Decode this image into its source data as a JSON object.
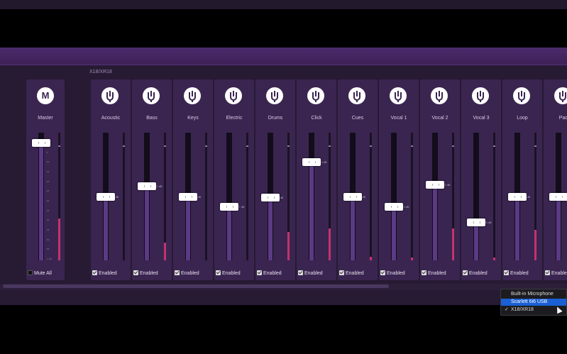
{
  "bus_label": "X18/XR18",
  "master": {
    "knob_letter": "M",
    "name": "Master",
    "level": 0.92,
    "meter": 0.33,
    "scale": [
      "0",
      "-5",
      "-10",
      "-15",
      "-20",
      "-25",
      "-30",
      "-35",
      "-40",
      "-45",
      "-50",
      "-55",
      "-∞ dB"
    ],
    "mute_label": "Mute All"
  },
  "channels": [
    {
      "name": "Acoustic",
      "gain": "-dB",
      "level": 0.5,
      "meter": 0.0,
      "enabled_label": "Enabled"
    },
    {
      "name": "Bass",
      "gain": "-2 dB",
      "level": 0.58,
      "meter": 0.14,
      "enabled_label": "Enabled"
    },
    {
      "name": "Keys",
      "gain": "-dB",
      "level": 0.5,
      "meter": 0.0,
      "enabled_label": "Enabled"
    },
    {
      "name": "Electric",
      "gain": "-7 dB",
      "level": 0.42,
      "meter": 0.0,
      "enabled_label": "Enabled"
    },
    {
      "name": "Drums",
      "gain": "-dB",
      "level": 0.49,
      "meter": 0.22,
      "enabled_label": "Enabled"
    },
    {
      "name": "Click",
      "gain": "-3 dB",
      "level": 0.77,
      "meter": 0.25,
      "enabled_label": "Enabled"
    },
    {
      "name": "Cues",
      "gain": "-dB",
      "level": 0.5,
      "meter": 0.03,
      "enabled_label": "Enabled"
    },
    {
      "name": "Vocal 1",
      "gain": "-5 dB",
      "level": 0.42,
      "meter": 0.02,
      "enabled_label": "Enabled"
    },
    {
      "name": "Vocal 2",
      "gain": "-2 dB",
      "level": 0.59,
      "meter": 0.25,
      "enabled_label": "Enabled"
    },
    {
      "name": "Vocal 3",
      "gain": "-5 dB",
      "level": 0.3,
      "meter": 0.02,
      "enabled_label": "Enabled"
    },
    {
      "name": "Loop",
      "gain": "-dB",
      "level": 0.5,
      "meter": 0.24,
      "enabled_label": "Enabled"
    },
    {
      "name": "Pad",
      "gain": "",
      "level": 0.5,
      "meter": 0.2,
      "enabled_label": "Enabled"
    }
  ],
  "device_menu": {
    "items": [
      "Built-in Microphone",
      "Scarlett 6i6 USB",
      "X18/XR18"
    ],
    "highlighted": "Scarlett 6i6 USB",
    "checked": "X18/XR18"
  },
  "colors": {
    "accent": "#5b3a85",
    "meter_peak": "#c2336e",
    "menu_highlight": "#1a5fd3"
  }
}
